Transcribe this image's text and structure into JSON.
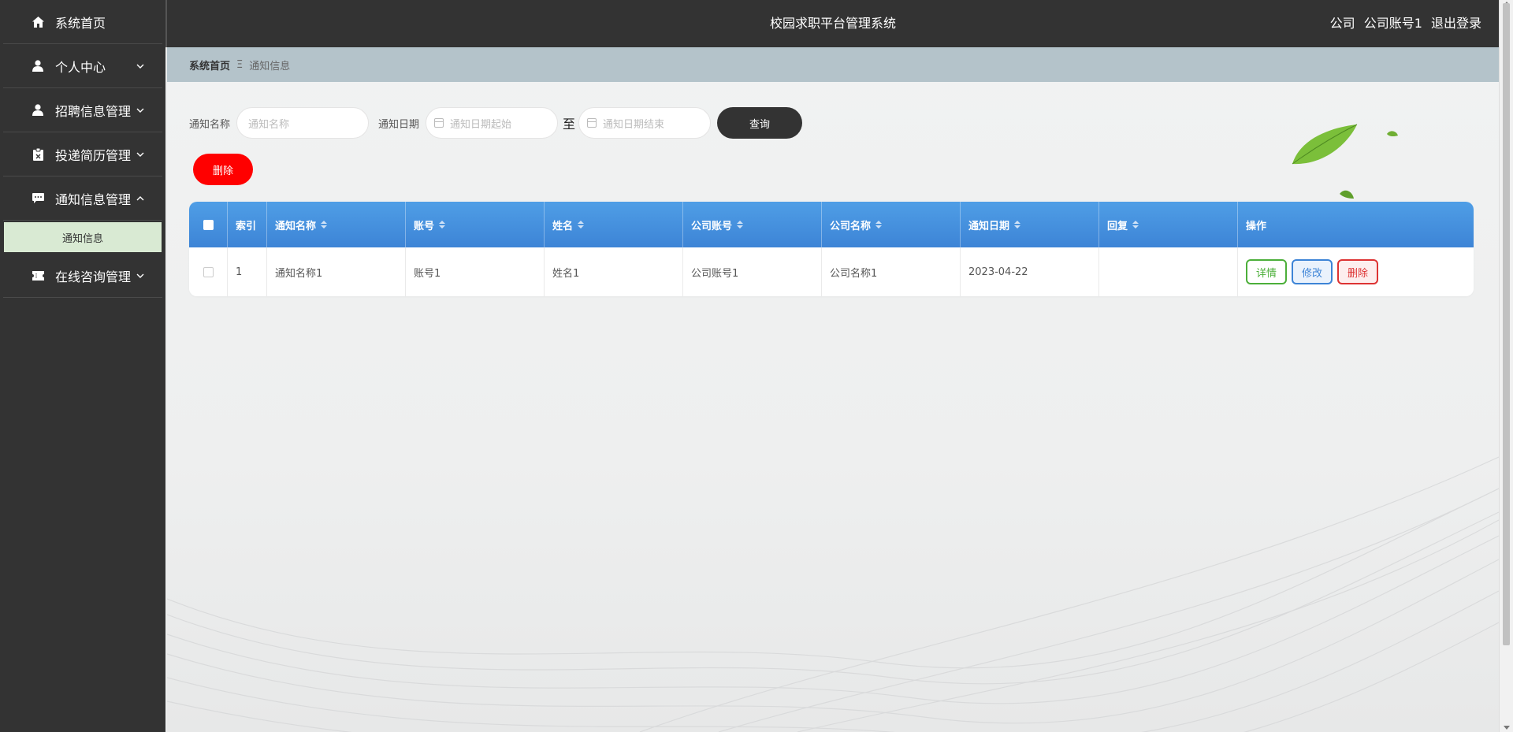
{
  "header": {
    "title": "校园求职平台管理系统",
    "role": "公司",
    "account": "公司账号1",
    "logout": "退出登录"
  },
  "sidebar": {
    "items": [
      {
        "label": "系统首页",
        "icon": "home-icon"
      },
      {
        "label": "个人中心",
        "icon": "user-icon"
      },
      {
        "label": "招聘信息管理",
        "icon": "user-icon"
      },
      {
        "label": "投递简历管理",
        "icon": "clipboard-icon"
      },
      {
        "label": "通知信息管理",
        "icon": "chat-icon",
        "expanded": true
      },
      {
        "label": "在线咨询管理",
        "icon": "ticket-icon"
      }
    ],
    "submenu": {
      "label": "通知信息"
    }
  },
  "breadcrumb": {
    "home": "系统首页",
    "separator": "Ξ",
    "current": "通知信息"
  },
  "search": {
    "name_label": "通知名称",
    "name_placeholder": "通知名称",
    "date_label": "通知日期",
    "date_start_placeholder": "通知日期起始",
    "to": "至",
    "date_end_placeholder": "通知日期结束",
    "query_button": "查询"
  },
  "actions": {
    "delete_button": "删除"
  },
  "table": {
    "columns": [
      "索引",
      "通知名称",
      "账号",
      "姓名",
      "公司账号",
      "公司名称",
      "通知日期",
      "回复",
      "操作"
    ],
    "rows": [
      {
        "index": "1",
        "name": "通知名称1",
        "account": "账号1",
        "person": "姓名1",
        "company_account": "公司账号1",
        "company_name": "公司名称1",
        "date": "2023-04-22",
        "reply": ""
      }
    ],
    "op_detail": "详情",
    "op_edit": "修改",
    "op_delete": "删除"
  },
  "colors": {
    "sidebar_bg": "#333333",
    "header_bg": "#333333",
    "table_header": "#4a94e0",
    "delete_red": "#ff0000"
  }
}
